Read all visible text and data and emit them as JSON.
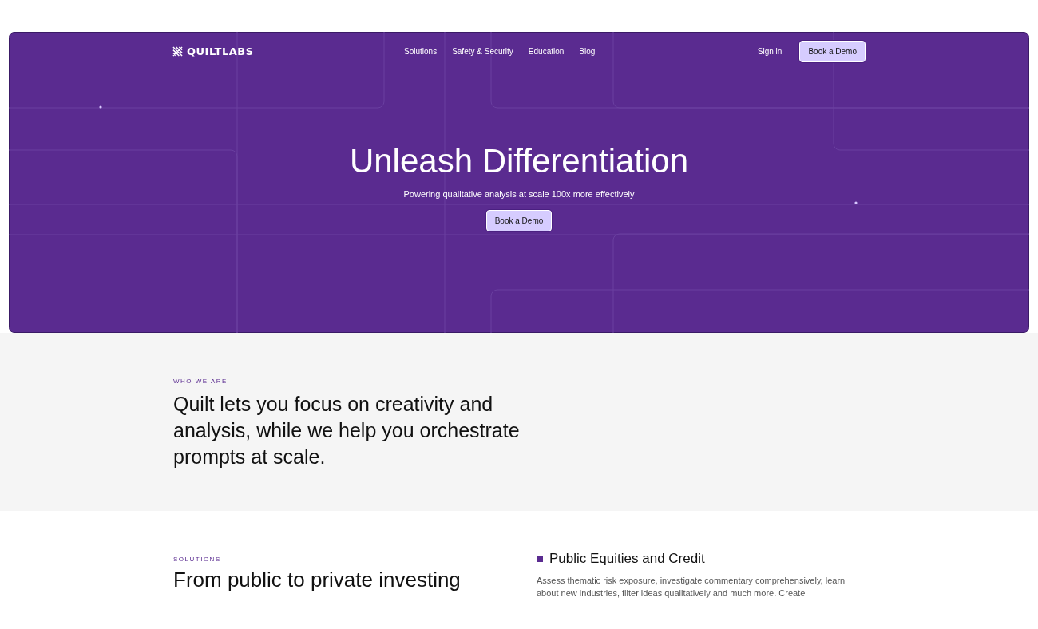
{
  "nav": {
    "logo": "QUILTLABS",
    "links": [
      "Solutions",
      "Safety & Security",
      "Education",
      "Blog"
    ],
    "sign_in": "Sign in",
    "cta": "Book a Demo"
  },
  "hero": {
    "title": "Unleash Differentiation",
    "subtitle": "Powering qualitative analysis at scale 100x more effectively",
    "cta": "Book a Demo"
  },
  "who_we_are": {
    "eyebrow": "WHO WE ARE",
    "heading": "Quilt lets you focus on creativity and analysis, while we help you orchestrate prompts at scale."
  },
  "solutions": {
    "eyebrow": "SOLUTIONS",
    "heading": "From public to private investing",
    "item": {
      "title": "Public Equities and Credit",
      "text": "Assess thematic risk exposure, investigate commentary comprehensively, learn about new industries, filter ideas qualitatively and much more. Create"
    }
  }
}
